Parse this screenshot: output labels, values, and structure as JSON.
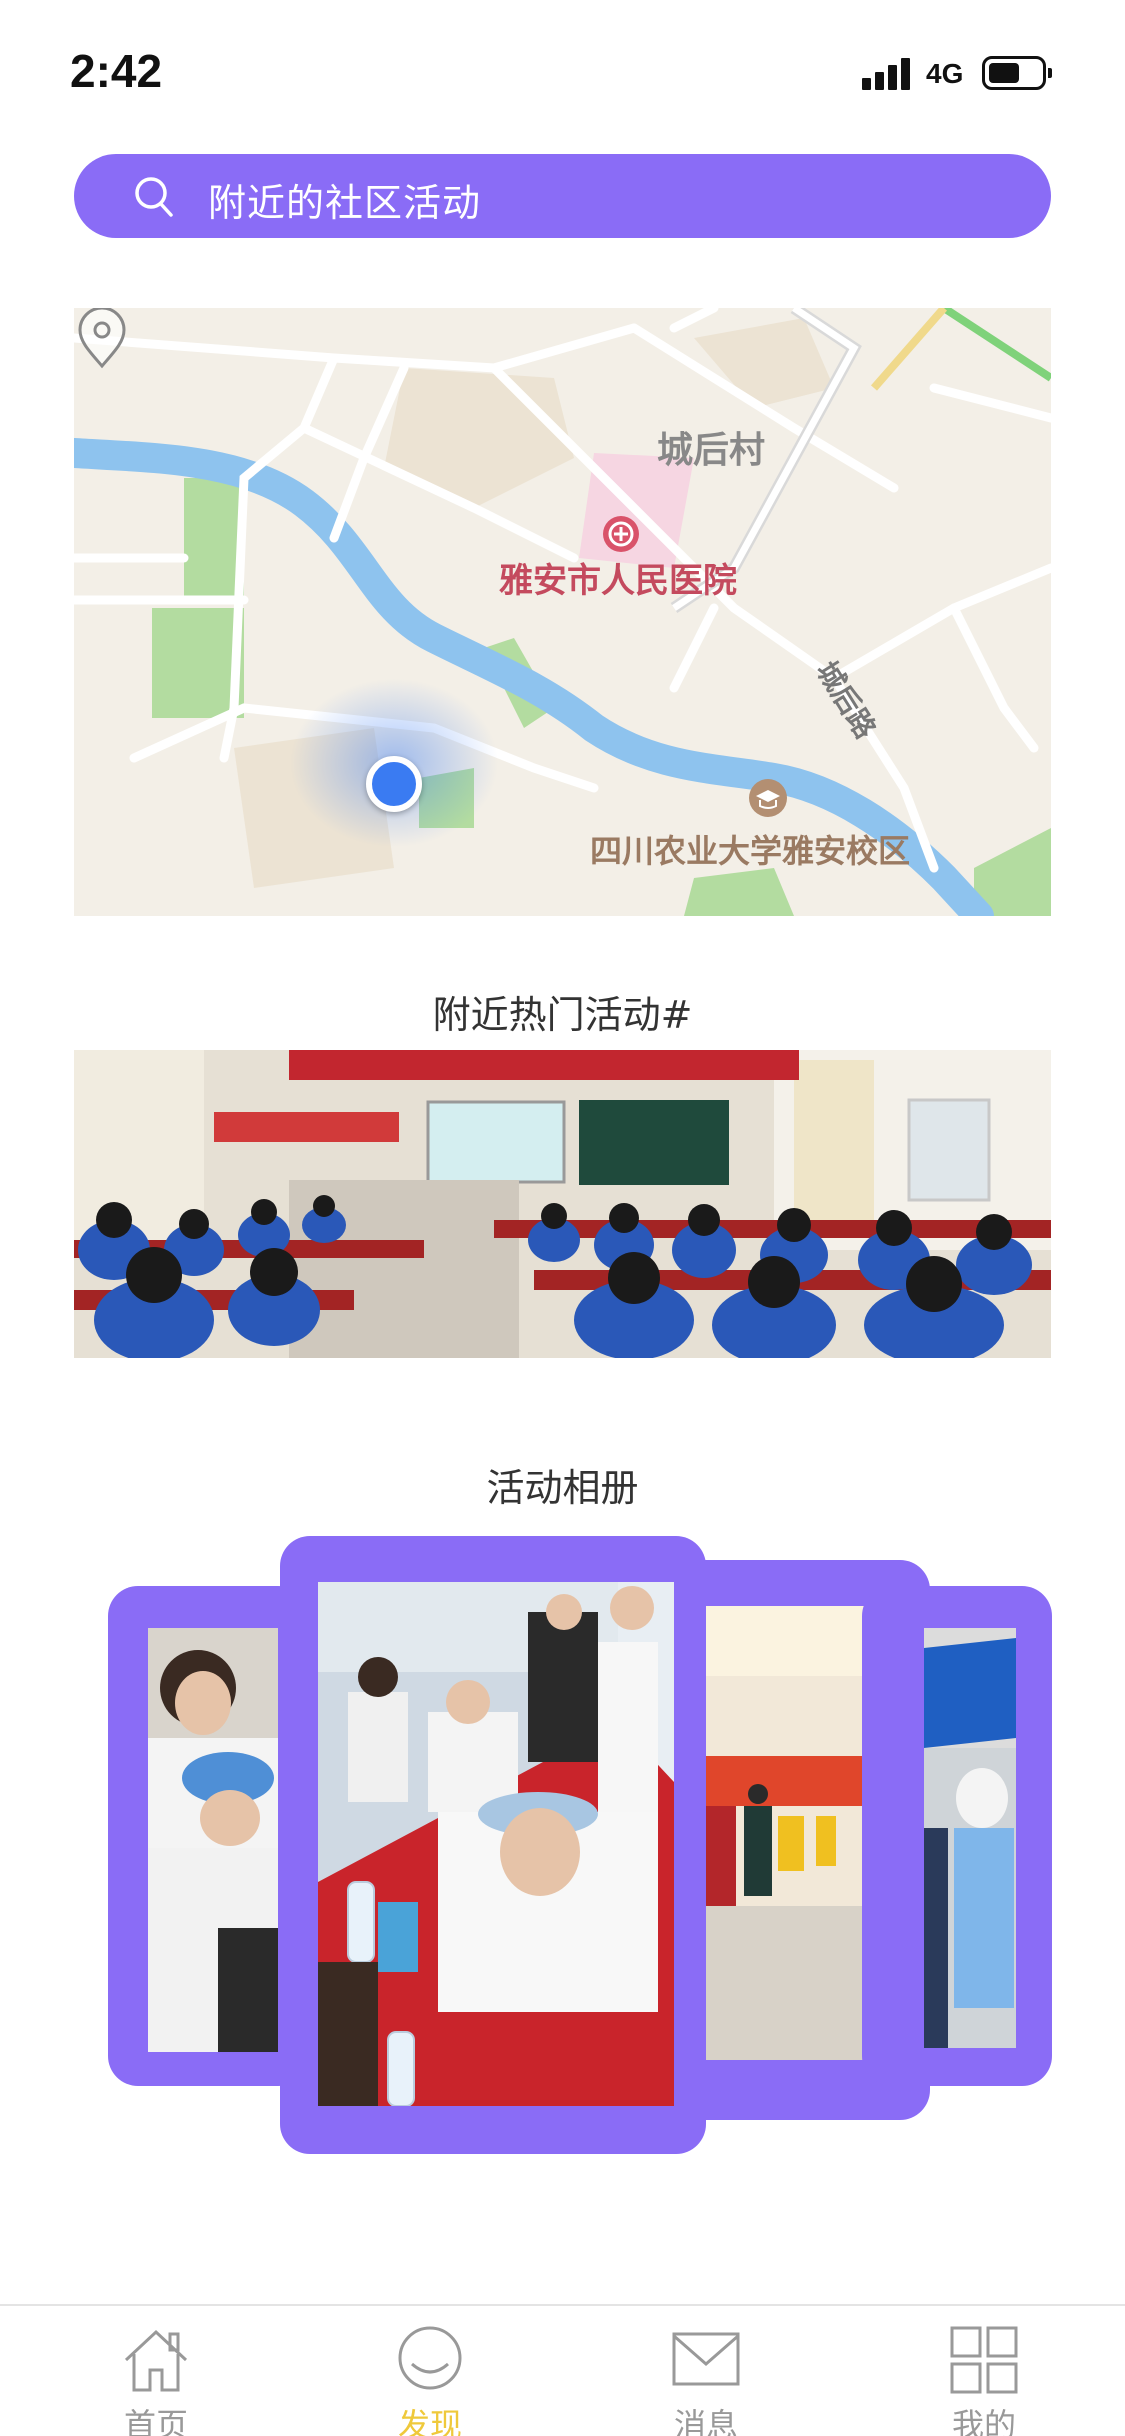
{
  "status_bar": {
    "time": "2:42",
    "network": "4G"
  },
  "search": {
    "placeholder": "附近的社区活动",
    "icon": "search-icon"
  },
  "map": {
    "labels": {
      "village": "城后村",
      "hospital": "雅安市人民医院",
      "road": "城后路",
      "university": "四川农业大学雅安校区"
    },
    "colors": {
      "river": "#8ec3ee",
      "park": "#b3dca0",
      "hospital_area": "#f6d6e2",
      "location": "#3a7bf2"
    }
  },
  "sections": {
    "hot_activities_title": "附近热门活动#",
    "album_title": "活动相册"
  },
  "colors": {
    "accent": "#8a6cf6",
    "tab_active": "#efc93b",
    "tab_inactive": "#999999"
  },
  "tab_bar": {
    "items": [
      {
        "label": "首页",
        "icon": "home-icon",
        "active": false
      },
      {
        "label": "发现",
        "icon": "discover-icon",
        "active": true
      },
      {
        "label": "消息",
        "icon": "mail-icon",
        "active": false
      },
      {
        "label": "我的",
        "icon": "grid-icon",
        "active": false
      }
    ]
  }
}
